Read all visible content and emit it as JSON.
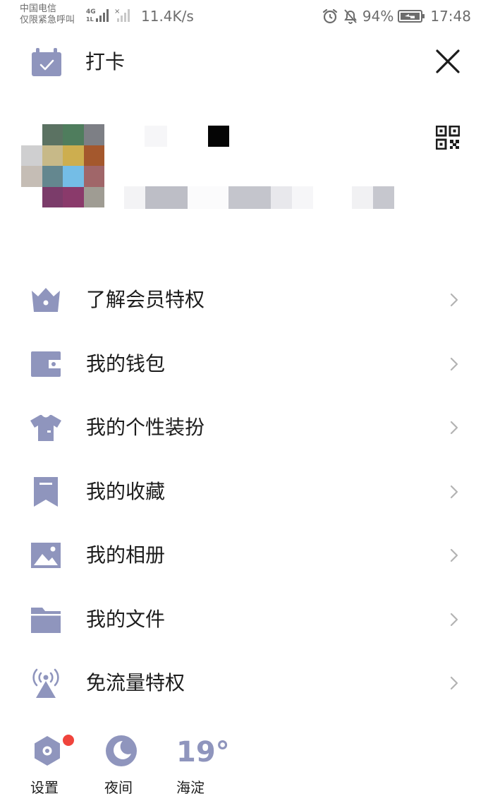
{
  "status_bar": {
    "carrier_line1": "中国电信",
    "carrier_line2": "仅限紧急呼叫",
    "net_speed": "11.4K/s",
    "battery_percent": "94%",
    "time": "17:48"
  },
  "header": {
    "checkin_label": "打卡"
  },
  "menu": {
    "items": [
      {
        "label": "了解会员特权",
        "icon": "crown-icon"
      },
      {
        "label": "我的钱包",
        "icon": "wallet-icon"
      },
      {
        "label": "我的个性装扮",
        "icon": "shirt-icon"
      },
      {
        "label": "我的收藏",
        "icon": "bookmark-icon"
      },
      {
        "label": "我的相册",
        "icon": "photo-icon"
      },
      {
        "label": "我的文件",
        "icon": "folder-icon"
      },
      {
        "label": "免流量特权",
        "icon": "signal-tower-icon"
      }
    ]
  },
  "bottom_bar": {
    "settings_label": "设置",
    "night_label": "夜间",
    "temperature": "19°",
    "location": "海淀"
  },
  "colors": {
    "icon": "#8f95bd",
    "chevron": "#b3b3b3",
    "badge": "#f0443c",
    "text": "#1c1c1c"
  }
}
